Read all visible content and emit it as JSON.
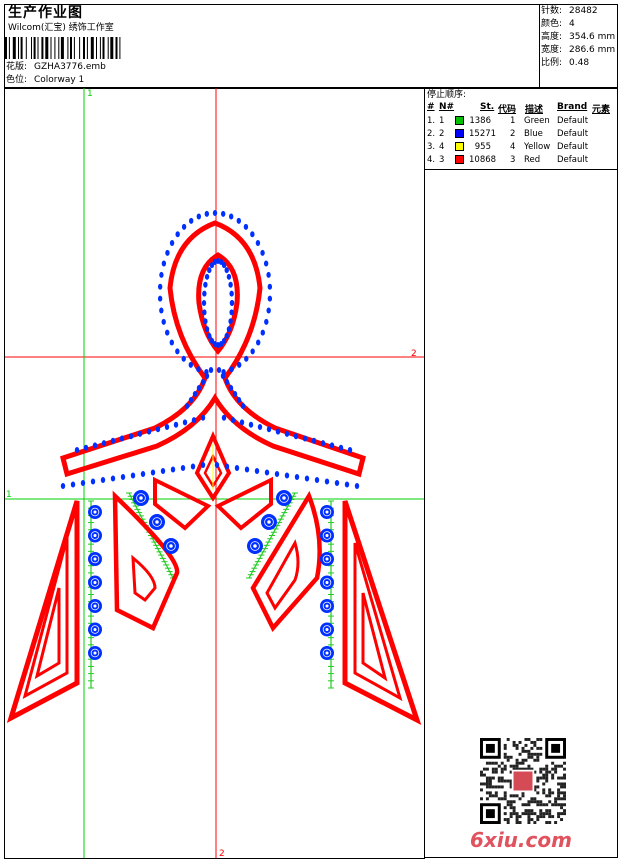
{
  "header": {
    "title": "生产作业图",
    "software": "Wilcom(汇宝) 绣饰工作室",
    "design_label": "花版:",
    "design_file": "GZHA3776.emb",
    "colorway_label": "色位:",
    "colorway_value": "Colorway 1"
  },
  "stats": {
    "stitches_label": "针数:",
    "stitches": "28482",
    "colors_label": "颜色:",
    "colors": "4",
    "height_label": "高度:",
    "height": "354.6 mm",
    "width_label": "宽度:",
    "width": "286.6 mm",
    "scale_label": "比例:",
    "scale": "0.48"
  },
  "stop_sequence": {
    "title": "停止顺序:",
    "columns": [
      "#",
      "N#",
      "St.",
      "代码",
      "描述",
      "Brand",
      "元素"
    ],
    "rows": [
      {
        "idx": "1.",
        "n": "1",
        "color": "#00c000",
        "stitches": "1386",
        "code": "1",
        "desc": "Green",
        "brand": "Default"
      },
      {
        "idx": "2.",
        "n": "2",
        "color": "#0000ff",
        "stitches": "15271",
        "code": "2",
        "desc": "Blue",
        "brand": "Default"
      },
      {
        "idx": "3.",
        "n": "4",
        "color": "#ffff00",
        "stitches": "955",
        "code": "4",
        "desc": "Yellow",
        "brand": "Default"
      },
      {
        "idx": "4.",
        "n": "3",
        "color": "#ff0000",
        "stitches": "10868",
        "code": "3",
        "desc": "Red",
        "brand": "Default"
      }
    ]
  },
  "guides": {
    "horizontal_labels": [
      "2",
      "1"
    ],
    "vertical_labels": [
      "1",
      "2"
    ],
    "green": "#00d000",
    "red": "#ff0000"
  },
  "colors": {
    "outline_red": "#ff0000",
    "bead_blue": "#0030ff",
    "stitch_green": "#22cc22"
  },
  "watermark": {
    "logo_text": "6xiu.com",
    "qr_icon": "qr-code-icon"
  }
}
